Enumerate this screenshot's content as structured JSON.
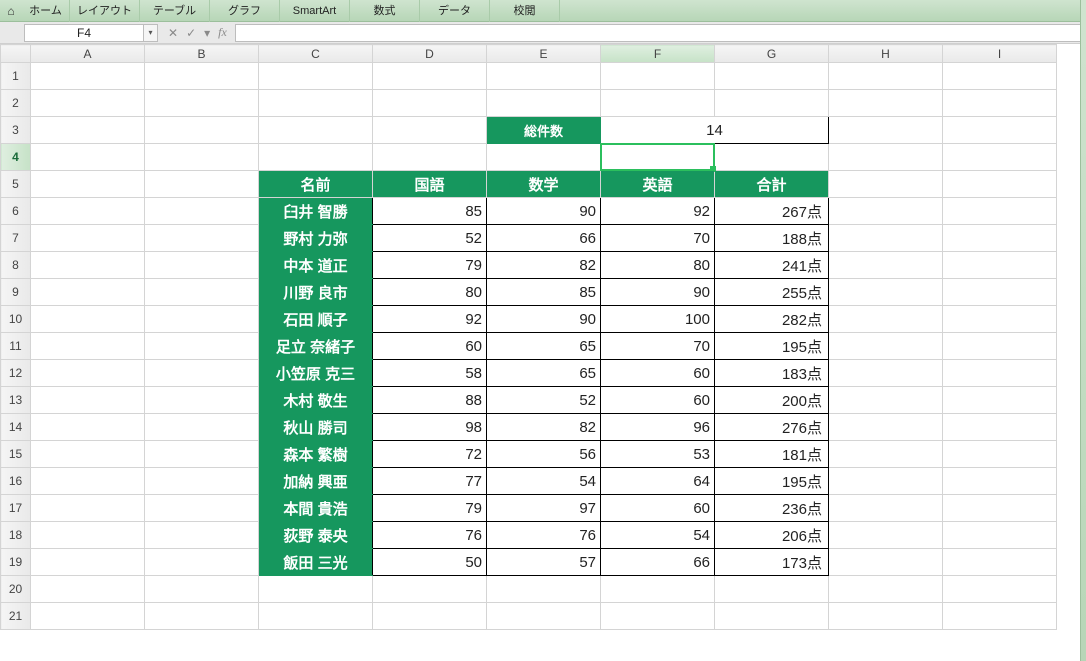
{
  "ribbon": {
    "tabs": [
      "ホーム",
      "レイアウト",
      "テーブル",
      "グラフ",
      "SmartArt",
      "数式",
      "データ",
      "校閲"
    ]
  },
  "formula_bar": {
    "name_box": "F4",
    "cancel_icon": "✕",
    "confirm_icon": "✓",
    "fx_icon": "fx",
    "formula_value": ""
  },
  "columns": [
    "A",
    "B",
    "C",
    "D",
    "E",
    "F",
    "G",
    "H",
    "I"
  ],
  "rows": [
    "1",
    "2",
    "3",
    "4",
    "5",
    "6",
    "7",
    "8",
    "9",
    "10",
    "11",
    "12",
    "13",
    "14",
    "15",
    "16",
    "17",
    "18",
    "19",
    "20",
    "21"
  ],
  "summary": {
    "label": "総件数",
    "value": "14"
  },
  "table": {
    "headers": {
      "name": "名前",
      "kokugo": "国語",
      "sugaku": "数学",
      "eigo": "英語",
      "gokei": "合計"
    },
    "rows": [
      {
        "name": "臼井 智勝",
        "k": "85",
        "s": "90",
        "e": "92",
        "g": "267点"
      },
      {
        "name": "野村 力弥",
        "k": "52",
        "s": "66",
        "e": "70",
        "g": "188点"
      },
      {
        "name": "中本 道正",
        "k": "79",
        "s": "82",
        "e": "80",
        "g": "241点"
      },
      {
        "name": "川野 良市",
        "k": "80",
        "s": "85",
        "e": "90",
        "g": "255点"
      },
      {
        "name": "石田 順子",
        "k": "92",
        "s": "90",
        "e": "100",
        "g": "282点"
      },
      {
        "name": "足立 奈緒子",
        "k": "60",
        "s": "65",
        "e": "70",
        "g": "195点"
      },
      {
        "name": "小笠原 克三",
        "k": "58",
        "s": "65",
        "e": "60",
        "g": "183点"
      },
      {
        "name": "木村 敬生",
        "k": "88",
        "s": "52",
        "e": "60",
        "g": "200点"
      },
      {
        "name": "秋山 勝司",
        "k": "98",
        "s": "82",
        "e": "96",
        "g": "276点"
      },
      {
        "name": "森本 繁樹",
        "k": "72",
        "s": "56",
        "e": "53",
        "g": "181点"
      },
      {
        "name": "加納 興亜",
        "k": "77",
        "s": "54",
        "e": "64",
        "g": "195点"
      },
      {
        "name": "本間 貴浩",
        "k": "79",
        "s": "97",
        "e": "60",
        "g": "236点"
      },
      {
        "name": "荻野 泰央",
        "k": "76",
        "s": "76",
        "e": "54",
        "g": "206点"
      },
      {
        "name": "飯田 三光",
        "k": "50",
        "s": "57",
        "e": "66",
        "g": "173点"
      }
    ]
  },
  "active_cell": "F4"
}
